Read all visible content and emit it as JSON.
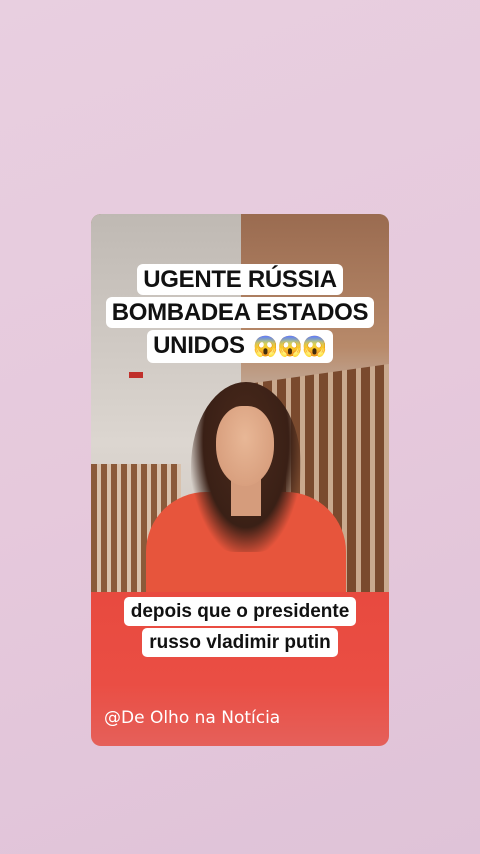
{
  "headline": {
    "line1": "UGENTE RÚSSIA",
    "line2": "BOMBADEA ESTADOS",
    "line3": "UNIDOS",
    "emojis": "😱😱😱"
  },
  "caption": {
    "line1": "depois que o presidente",
    "line2": "russo vladimir putin"
  },
  "watermark": "@De Olho na Notícia",
  "colors": {
    "background": "#e6c9dc",
    "red_band": "#e84a3f",
    "caption_bg": "#ffffff"
  }
}
